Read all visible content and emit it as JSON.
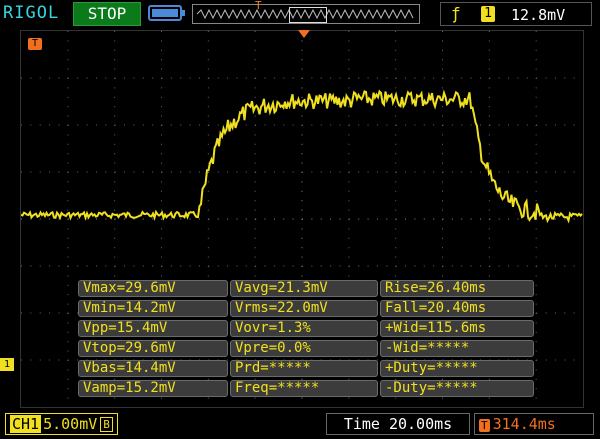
{
  "top": {
    "brand": "RIGOL",
    "run_state": "STOP",
    "trigger_source": "1",
    "trigger_level": "12.8mV"
  },
  "markers": {
    "trigger_marker": "T",
    "ch1_marker": "1"
  },
  "measurements": [
    [
      "Vmax=29.6mV",
      "Vavg=21.3mV",
      "Rise=26.40ms"
    ],
    [
      "Vmin=14.2mV",
      "Vrms=22.0mV",
      "Fall=20.40ms"
    ],
    [
      "Vpp=15.4mV",
      "Vovr=1.3%",
      "+Wid=115.6ms"
    ],
    [
      "Vtop=29.6mV",
      "Vpre=0.0%",
      "-Wid=*****"
    ],
    [
      "Vbas=14.4mV",
      "Prd=*****",
      "+Duty=*****"
    ],
    [
      "Vamp=15.2mV",
      "Freq=*****",
      "-Duty=*****"
    ]
  ],
  "bottom": {
    "ch1_label": "CH1",
    "ch1_scale": "5.00mV",
    "ch1_bw": "B",
    "timebase": "Time 20.00ms",
    "h_offset_icon": "T",
    "h_offset": "314.4ms"
  },
  "colors": {
    "ch1": "#f0e020",
    "trigger": "#f07020",
    "brand": "#3ad3e0",
    "stop_bg": "#0a7a1a"
  },
  "icons": [
    "battery-icon",
    "rising-edge-icon",
    "memory-depth-icon"
  ]
}
